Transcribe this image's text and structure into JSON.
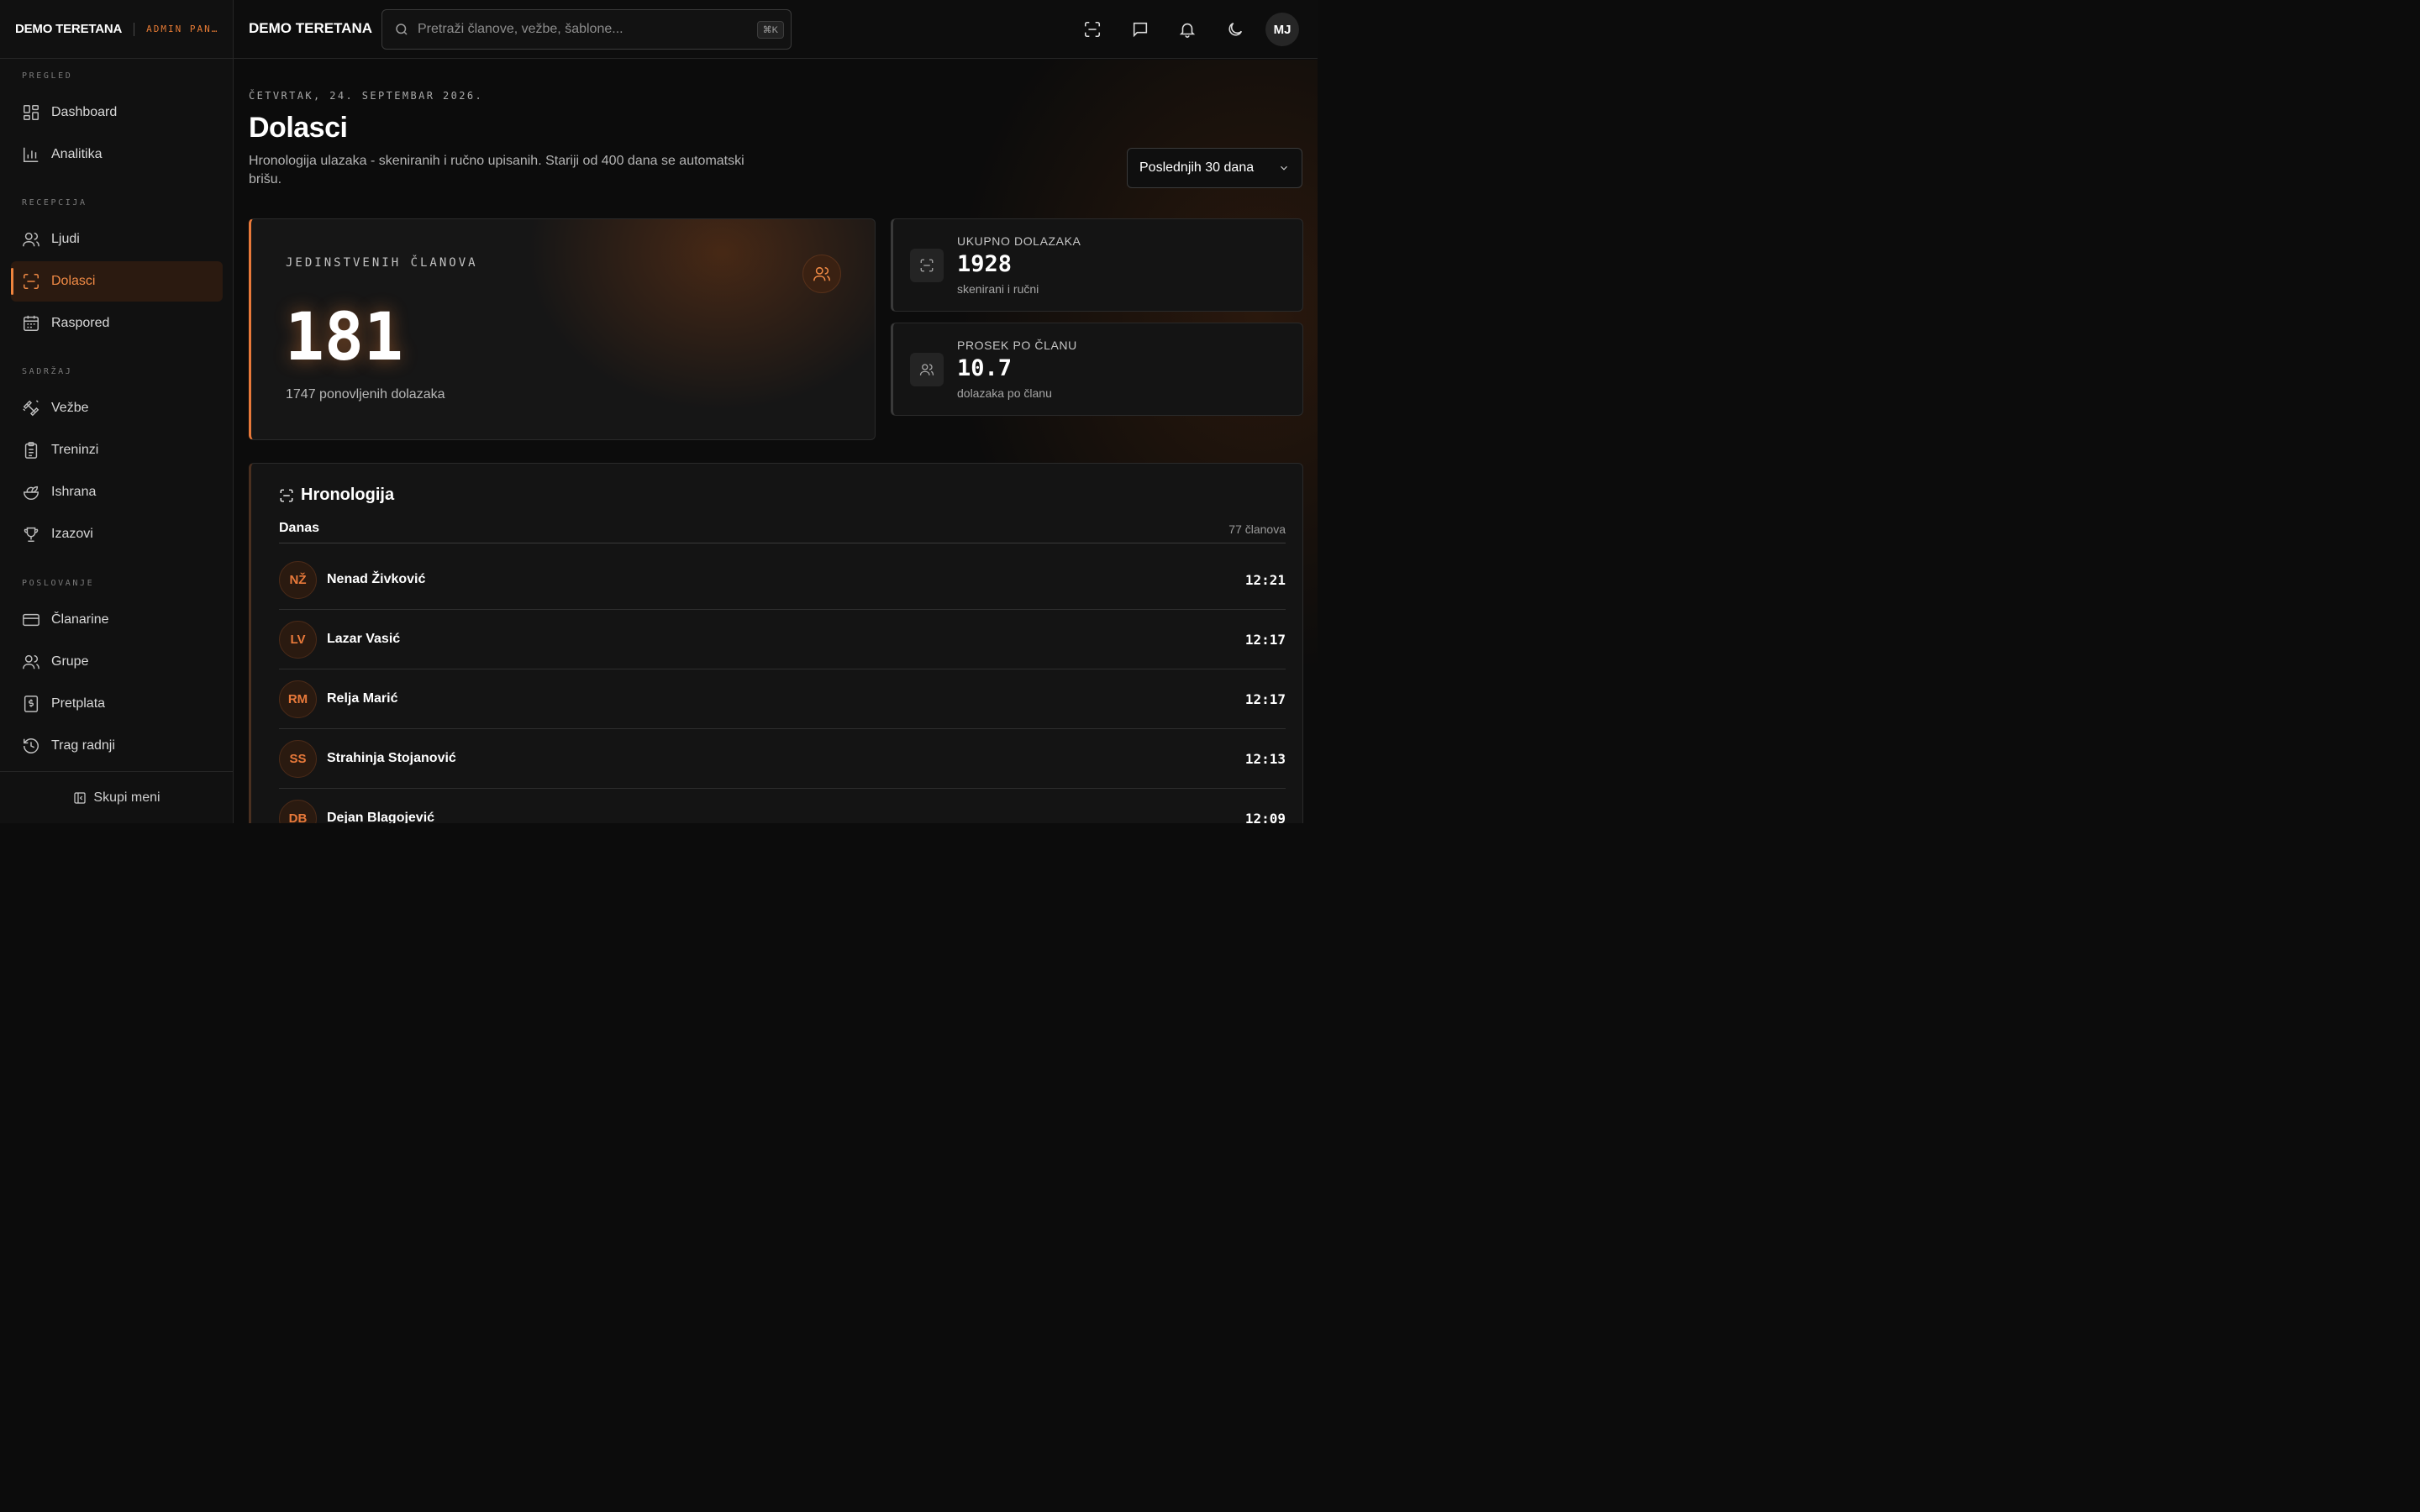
{
  "brand": {
    "name": "DEMO TERETANA",
    "subtitle": "ADMIN PAN…"
  },
  "sidebar": {
    "sections": [
      {
        "title": "PREGLED",
        "items": [
          {
            "label": "Dashboard",
            "icon": "dashboard-icon"
          },
          {
            "label": "Analitika",
            "icon": "bar-chart-icon"
          }
        ]
      },
      {
        "title": "RECEPCIJA",
        "items": [
          {
            "label": "Ljudi",
            "icon": "users-icon"
          },
          {
            "label": "Dolasci",
            "icon": "scan-icon",
            "active": true
          },
          {
            "label": "Raspored",
            "icon": "calendar-icon"
          }
        ]
      },
      {
        "title": "SADRŽAJ",
        "items": [
          {
            "label": "Vežbe",
            "icon": "dumbbell-icon"
          },
          {
            "label": "Treninzi",
            "icon": "clipboard-icon"
          },
          {
            "label": "Ishrana",
            "icon": "salad-icon"
          },
          {
            "label": "Izazovi",
            "icon": "trophy-icon"
          }
        ]
      },
      {
        "title": "POSLOVANJE",
        "items": [
          {
            "label": "Članarine",
            "icon": "credit-card-icon"
          },
          {
            "label": "Grupe",
            "icon": "users-icon"
          },
          {
            "label": "Pretplata",
            "icon": "receipt-icon"
          },
          {
            "label": "Trag radnji",
            "icon": "history-icon"
          }
        ]
      }
    ],
    "collapse_label": "Skupi meni"
  },
  "topbar": {
    "title": "DEMO TERETANA",
    "search_placeholder": "Pretraži članove, vežbe, šablone...",
    "shortcut": "⌘K",
    "user_initials": "MJ"
  },
  "page": {
    "date": "ČETVRTAK, 24. SEPTEMBAR 2026.",
    "title": "Dolasci",
    "description": "Hronologija ulazaka - skeniranih i ručno upisanih. Stariji od 400 dana se automatski brišu.",
    "period": "Poslednjih 30 dana"
  },
  "hero": {
    "label": "JEDINSTVENIH ČLANOVA",
    "value": "181",
    "sub": "1747 ponovljenih dolazaka"
  },
  "stats": [
    {
      "label": "UKUPNO DOLAZAKA",
      "value": "1928",
      "sub": "skenirani i ručni"
    },
    {
      "label": "PROSEK PO ČLANU",
      "value": "10.7",
      "sub": "dolazaka po članu"
    }
  ],
  "timeline": {
    "title": "Hronologija",
    "group": "Danas",
    "count": "77 članova",
    "rows": [
      {
        "initials": "NŽ",
        "name": "Nenad Živković",
        "time": "12:21"
      },
      {
        "initials": "LV",
        "name": "Lazar Vasić",
        "time": "12:17"
      },
      {
        "initials": "RM",
        "name": "Relja Marić",
        "time": "12:17"
      },
      {
        "initials": "SS",
        "name": "Strahinja Stojanović",
        "time": "12:13"
      },
      {
        "initials": "DB",
        "name": "Dejan Blagojević",
        "time": "12:09"
      }
    ]
  },
  "colors": {
    "accent": "#e8793a",
    "background": "#0c0c0c",
    "panel": "#141414"
  }
}
